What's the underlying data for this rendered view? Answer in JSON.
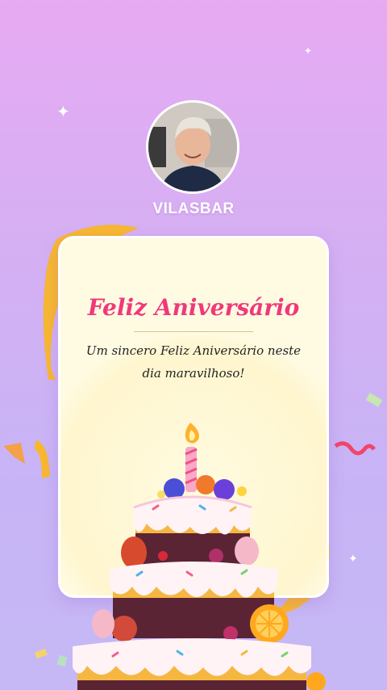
{
  "profile": {
    "name": "VILASBAR"
  },
  "card": {
    "title": "Feliz Aniversário",
    "message": "Um sincero Feliz Aniversário neste dia maravilhoso!"
  },
  "colors": {
    "background_top": "#e7aaf3",
    "background_bottom": "#c6b8f5",
    "card": "#fffbe3",
    "title": "#f0397a",
    "ribbon": "#f7b731"
  },
  "icons": [
    "sparkle-icon",
    "confetti-icon",
    "candle-icon",
    "birthday-cake-illustration",
    "ribbon-decoration"
  ]
}
